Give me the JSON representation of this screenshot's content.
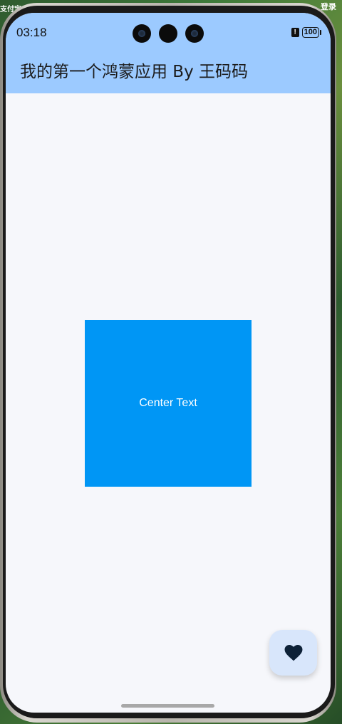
{
  "background": {
    "left_text": "支付宝",
    "right_text": "登录"
  },
  "status_bar": {
    "time": "03:18",
    "alert_glyph": "!",
    "battery_level": "100"
  },
  "header": {
    "title": "我的第一个鸿蒙应用 By 王码码",
    "background_color": "#9ccaff"
  },
  "content": {
    "center_text": "Center Text",
    "box_color": "#0096f5"
  },
  "fab": {
    "icon": "heart-icon",
    "background_color": "#d8e6fb"
  }
}
